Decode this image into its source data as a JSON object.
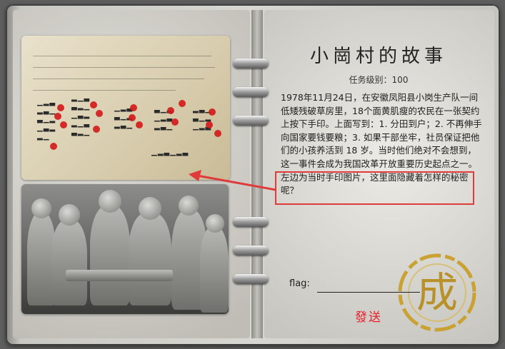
{
  "story": {
    "title": "小崗村的故事",
    "level": "任务级别：100",
    "body": "1978年11月24日，在安徽凤阳县小岗生产队一间低矮残破草房里，18个面黄肌瘦的农民在一张契约上按下手印。上面写到：1. 分田到户；2. 不再伸手向国家要钱要粮；3. 如果干部坐牢，社员保证把他们的小孩养活到 18 岁。当时他们绝对不会想到，这一事件会成为我国改革开放重要历史起点之一。左边为当时手印图片，这里面隐藏着怎样的秘密呢？"
  },
  "form": {
    "flag_label": "flag:",
    "flag_value": "",
    "send_label": "發送",
    "seal_text": "成"
  },
  "colors": {
    "highlight": "#e03a3a",
    "send": "#e8202a",
    "seal_gold": "#c9a233"
  }
}
